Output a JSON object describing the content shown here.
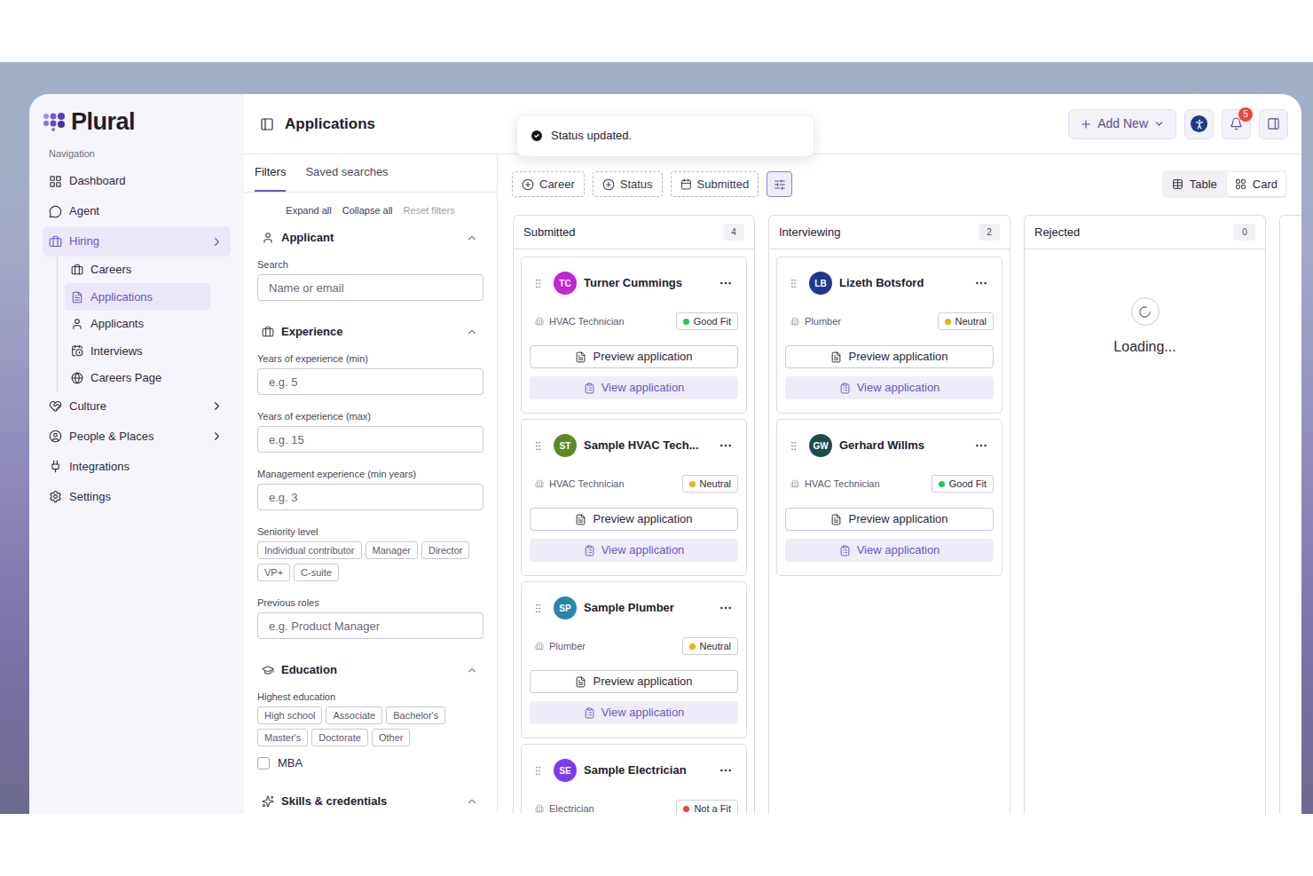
{
  "logo": "Plural",
  "sidebar": {
    "heading": "Navigation",
    "items": [
      {
        "label": "Dashboard",
        "selected": false,
        "expandable": false,
        "expanded": false,
        "children": []
      },
      {
        "label": "Agent",
        "selected": false,
        "expandable": false,
        "expanded": false,
        "children": []
      },
      {
        "label": "Hiring",
        "selected": true,
        "expandable": true,
        "expanded": true,
        "children": [
          {
            "label": "Careers",
            "selected": false
          },
          {
            "label": "Applications",
            "selected": true
          },
          {
            "label": "Applicants",
            "selected": false
          },
          {
            "label": "Interviews",
            "selected": false
          },
          {
            "label": "Careers Page",
            "selected": false
          }
        ]
      },
      {
        "label": "Culture",
        "selected": false,
        "expandable": true,
        "expanded": false,
        "children": []
      },
      {
        "label": "People & Places",
        "selected": false,
        "expandable": true,
        "expanded": false,
        "children": []
      },
      {
        "label": "Integrations",
        "selected": false,
        "expandable": false,
        "expanded": false,
        "children": []
      },
      {
        "label": "Settings",
        "selected": false,
        "expandable": false,
        "expanded": false,
        "children": []
      }
    ]
  },
  "header": {
    "title": "Applications",
    "add_button": "Add New",
    "notification_count": "5"
  },
  "toast": {
    "message": "Status updated."
  },
  "filters": {
    "tabs": [
      {
        "label": "Filters",
        "selected": true
      },
      {
        "label": "Saved searches",
        "selected": false
      }
    ],
    "actions": [
      {
        "label": "Expand all",
        "disabled": false
      },
      {
        "label": "Collapse all",
        "disabled": false
      },
      {
        "label": "Reset filters",
        "disabled": true
      }
    ],
    "sections": [
      {
        "title": "Applicant",
        "expanded": true,
        "fields": [
          {
            "kind": "input",
            "label": "Search",
            "placeholder": "Name or email"
          }
        ]
      },
      {
        "title": "Experience",
        "expanded": true,
        "fields": [
          {
            "kind": "input",
            "label": "Years of experience (min)",
            "placeholder": "e.g. 5"
          },
          {
            "kind": "input",
            "label": "Years of experience (max)",
            "placeholder": "e.g. 15"
          },
          {
            "kind": "input",
            "label": "Management experience (min years)",
            "placeholder": "e.g. 3"
          },
          {
            "kind": "chips",
            "label": "Seniority level",
            "options": [
              {
                "label": "Individual contributor",
                "selected": false
              },
              {
                "label": "Manager",
                "selected": false
              },
              {
                "label": "Director",
                "selected": false
              },
              {
                "label": "VP+",
                "selected": false
              },
              {
                "label": "C-suite",
                "selected": false
              }
            ]
          },
          {
            "kind": "input",
            "label": "Previous roles",
            "placeholder": "e.g. Product Manager"
          }
        ]
      },
      {
        "title": "Education",
        "expanded": true,
        "fields": [
          {
            "kind": "chips",
            "label": "Highest education",
            "options": [
              {
                "label": "High school",
                "selected": false
              },
              {
                "label": "Associate",
                "selected": false
              },
              {
                "label": "Bachelor's",
                "selected": false
              },
              {
                "label": "Master's",
                "selected": false
              },
              {
                "label": "Doctorate",
                "selected": false
              },
              {
                "label": "Other",
                "selected": false
              }
            ]
          },
          {
            "kind": "checkbox",
            "label": "MBA",
            "checked": false
          }
        ]
      },
      {
        "title": "Skills & credentials",
        "expanded": true,
        "fields": []
      }
    ]
  },
  "toolbar": {
    "filters": [
      {
        "label": "Career",
        "kind": "add"
      },
      {
        "label": "Status",
        "kind": "add"
      },
      {
        "label": "Submitted",
        "kind": "date"
      }
    ],
    "views": [
      {
        "label": "Table",
        "selected": false
      },
      {
        "label": "Card",
        "selected": true
      }
    ]
  },
  "board": {
    "columns": [
      {
        "title": "Submitted",
        "count": "4",
        "loading": false,
        "loading_text": "",
        "cards": [
          {
            "initials": "TC",
            "name": "Turner Cummings",
            "avatar_color": "#c026d3",
            "role": "HVAC Technician",
            "fit": "Good Fit",
            "fit_color": "#22c55e",
            "actions": [
              {
                "label": "Preview application",
                "kind": "preview"
              },
              {
                "label": "View application",
                "kind": "view"
              }
            ]
          },
          {
            "initials": "ST",
            "name": "Sample HVAC Tech...",
            "avatar_color": "#5b8a24",
            "role": "HVAC Technician",
            "fit": "Neutral",
            "fit_color": "#eab308",
            "actions": [
              {
                "label": "Preview application",
                "kind": "preview"
              },
              {
                "label": "View application",
                "kind": "view"
              }
            ]
          },
          {
            "initials": "SP",
            "name": "Sample Plumber",
            "avatar_color": "#2a86a6",
            "role": "Plumber",
            "fit": "Neutral",
            "fit_color": "#eab308",
            "actions": [
              {
                "label": "Preview application",
                "kind": "preview"
              },
              {
                "label": "View application",
                "kind": "view"
              }
            ]
          },
          {
            "initials": "SE",
            "name": "Sample Electrician",
            "avatar_color": "#7c3aed",
            "role": "Electrician",
            "fit": "Not a Fit",
            "fit_color": "#ef4444",
            "actions": []
          }
        ]
      },
      {
        "title": "Interviewing",
        "count": "2",
        "loading": false,
        "loading_text": "",
        "cards": [
          {
            "initials": "LB",
            "name": "Lizeth Botsford",
            "avatar_color": "#1e3a8a",
            "role": "Plumber",
            "fit": "Neutral",
            "fit_color": "#eab308",
            "actions": [
              {
                "label": "Preview application",
                "kind": "preview"
              },
              {
                "label": "View application",
                "kind": "view"
              }
            ]
          },
          {
            "initials": "GW",
            "name": "Gerhard Willms",
            "avatar_color": "#1f4a4a",
            "role": "HVAC Technician",
            "fit": "Good Fit",
            "fit_color": "#22c55e",
            "actions": [
              {
                "label": "Preview application",
                "kind": "preview"
              },
              {
                "label": "View application",
                "kind": "view"
              }
            ]
          }
        ]
      },
      {
        "title": "Rejected",
        "count": "0",
        "loading": true,
        "loading_text": "Loading...",
        "cards": []
      }
    ]
  }
}
